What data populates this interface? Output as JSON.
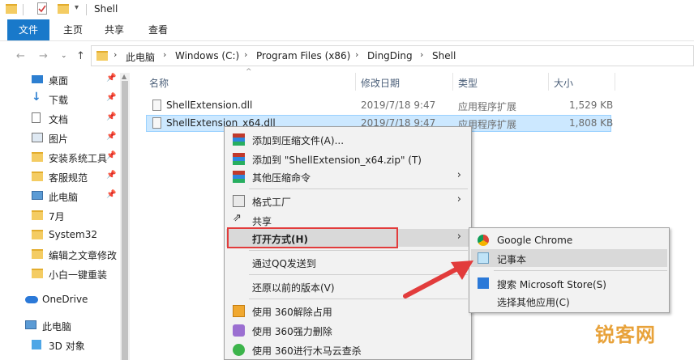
{
  "window": {
    "title": "Shell",
    "quick_access_icons": [
      "folder-icon",
      "checkmark-properties-icon",
      "folder-icon",
      "dropdown-icon"
    ]
  },
  "ribbon": {
    "tabs": [
      "文件",
      "主页",
      "共享",
      "查看"
    ]
  },
  "address": {
    "crumbs": [
      "此电脑",
      "Windows (C:)",
      "Program Files (x86)",
      "DingDing",
      "Shell"
    ]
  },
  "nav": {
    "items": [
      {
        "label": "桌面",
        "icon": "desktop-icon",
        "pinned": true
      },
      {
        "label": "下载",
        "icon": "download-arrow-icon",
        "pinned": true
      },
      {
        "label": "文档",
        "icon": "document-icon",
        "pinned": true
      },
      {
        "label": "图片",
        "icon": "picture-icon",
        "pinned": true
      },
      {
        "label": "安装系统工具",
        "icon": "folder-icon",
        "pinned": true
      },
      {
        "label": "客服规范",
        "icon": "folder-icon",
        "pinned": true
      },
      {
        "label": "此电脑",
        "icon": "computer-icon",
        "pinned": true
      },
      {
        "label": "7月",
        "icon": "folder-icon",
        "pinned": false
      },
      {
        "label": "System32",
        "icon": "folder-icon",
        "pinned": false
      },
      {
        "label": "编辑之文章修改",
        "icon": "folder-icon",
        "pinned": false
      },
      {
        "label": "小白一键重装",
        "icon": "folder-icon",
        "pinned": false
      },
      {
        "label": "OneDrive",
        "icon": "cloud-icon",
        "pinned": false
      },
      {
        "label": "此电脑",
        "icon": "computer-icon",
        "pinned": false
      },
      {
        "label": "3D 对象",
        "icon": "cube-3d-icon",
        "pinned": false
      }
    ]
  },
  "columns": {
    "name": "名称",
    "modified": "修改日期",
    "type": "类型",
    "size": "大小"
  },
  "files": [
    {
      "name": "ShellExtension.dll",
      "modified": "2019/7/18 9:47",
      "type": "应用程序扩展",
      "size": "1,529 KB"
    },
    {
      "name": "ShellExtension_x64.dll",
      "modified": "2019/7/18 9:47",
      "type": "应用程序扩展",
      "size": "1,808 KB"
    }
  ],
  "context_menu": {
    "items": {
      "add_archive": "添加到压缩文件(A)...",
      "add_zip": "添加到 \"ShellExtension_x64.zip\" (T)",
      "other_compress": "其他压缩命令",
      "format_factory": "格式工厂",
      "share": "共享",
      "open_with": "打开方式(H)",
      "send_qq": "通过QQ发送到",
      "restore_prev": "还原以前的版本(V)",
      "unlock_360": "使用 360解除占用",
      "force_delete_360": "使用 360强力删除",
      "trojan_scan_360": "使用 360进行木马云查杀"
    }
  },
  "open_with_submenu": {
    "items": {
      "chrome": "Google Chrome",
      "notepad": "记事本",
      "store": "搜索 Microsoft Store(S)",
      "choose_other": "选择其他应用(C)"
    }
  },
  "watermark": "锐客网",
  "colors": {
    "accent": "#1979ca",
    "selection": "#cce8ff",
    "highlight_box": "#e23c3c",
    "arrow": "#e23c3c",
    "watermark": "#e8a23a"
  }
}
